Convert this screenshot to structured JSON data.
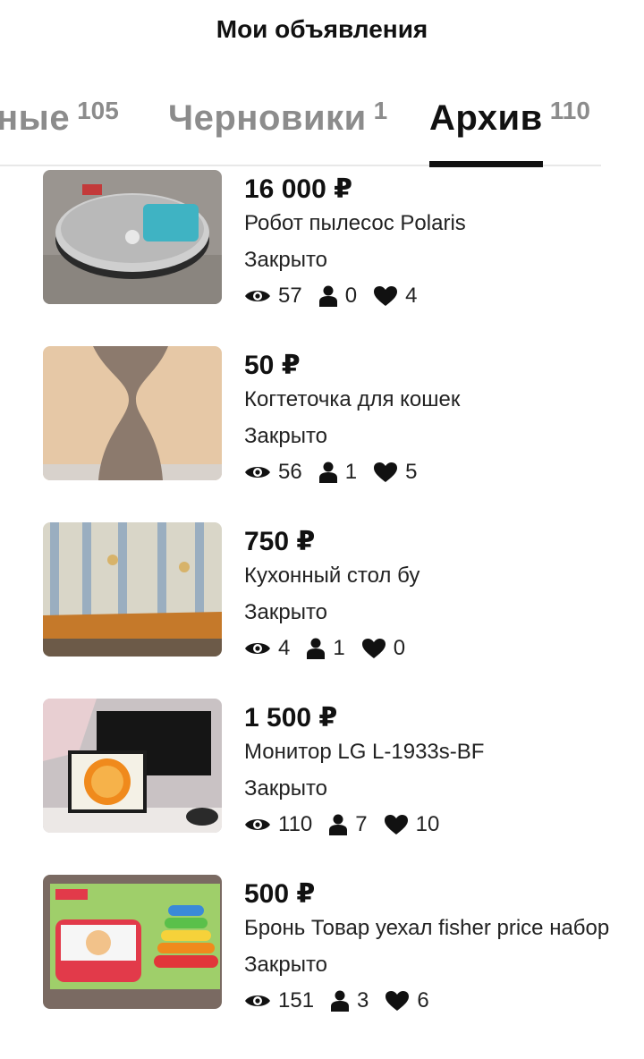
{
  "header": {
    "title": "Мои объявления"
  },
  "tabs": [
    {
      "label": "ные",
      "count": "105",
      "active": false
    },
    {
      "label": "Черновики",
      "count": "1",
      "active": false
    },
    {
      "label": "Архив",
      "count": "110",
      "active": true
    }
  ],
  "colors": {
    "accent": "#111111",
    "inactive_tab": "#8c8c8c",
    "divider": "#e8e8e8"
  },
  "items": [
    {
      "price": "16 000 ₽",
      "title": "Робот пылесос Polaris",
      "status": "Закрыто",
      "views": "57",
      "contacts": "0",
      "favorites": "4",
      "image_icon": "robot-vacuum-photo"
    },
    {
      "price": "50 ₽",
      "title": "Когтеточка для кошек",
      "status": "Закрыто",
      "views": "56",
      "contacts": "1",
      "favorites": "5",
      "image_icon": "cat-scratcher-photo"
    },
    {
      "price": "750 ₽",
      "title": "Кухонный стол бу",
      "status": "Закрыто",
      "views": "4",
      "contacts": "1",
      "favorites": "0",
      "image_icon": "kitchen-table-photo"
    },
    {
      "price": "1 500 ₽",
      "title": "Монитор LG L-1933s-BF",
      "status": "Закрыто",
      "views": "110",
      "contacts": "7",
      "favorites": "10",
      "image_icon": "monitor-photo"
    },
    {
      "price": "500 ₽",
      "title": "Бронь Товар уехал fisher price набор",
      "status": "Закрыто",
      "views": "151",
      "contacts": "3",
      "favorites": "6",
      "image_icon": "toy-set-photo"
    }
  ],
  "icons": {
    "views": "eye-icon",
    "contacts": "person-icon",
    "favorites": "heart-icon"
  }
}
